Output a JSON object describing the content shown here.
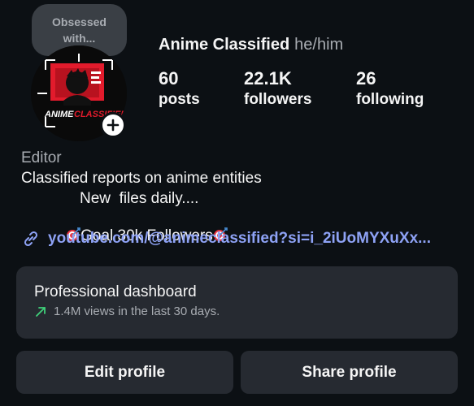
{
  "note": {
    "line1": "Obsessed",
    "line2": "with..."
  },
  "avatar": {
    "logo_text_white": "ANIME",
    "logo_text_red": "CLASSIFIED",
    "add_icon": "plus-icon"
  },
  "profile": {
    "display_name": "Anime Classified",
    "pronouns": "he/him"
  },
  "stats": [
    {
      "value": "60",
      "label": "posts"
    },
    {
      "value": "22.1K",
      "label": "followers"
    },
    {
      "value": "26",
      "label": "following"
    }
  ],
  "bio": {
    "category": "Editor",
    "line1": "Classified reports on anime entities",
    "line2": "New  files daily....",
    "line3": "Goal 30k Followers",
    "line3_emoji": "target-emoji",
    "link_icon": "link-icon",
    "link_text": "youtube.com/@animeclassified?si=i_2iUoMYXuXx..."
  },
  "dashboard": {
    "title": "Professional dashboard",
    "subtitle": "1.4M views in the last 30 days.",
    "trend_icon": "trending-up-arrow-icon"
  },
  "buttons": {
    "edit": "Edit profile",
    "share": "Share profile"
  },
  "colors": {
    "background": "#0c1014",
    "card": "#262a31",
    "link": "#8ea2f5",
    "trend": "#3fd07a",
    "muted_text": "#a8acb2",
    "logo_red": "#e21b2c"
  }
}
